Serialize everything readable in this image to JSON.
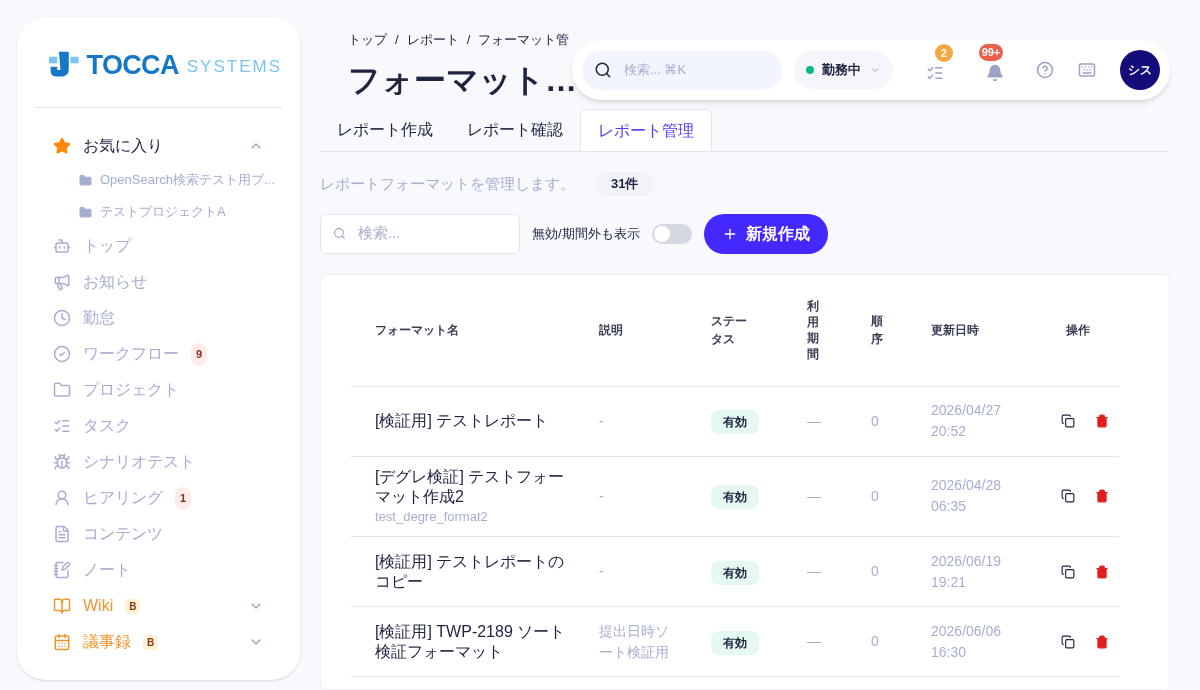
{
  "logo": {
    "name": "TOCCA",
    "suffix": "SYSTEMS"
  },
  "sidebar": {
    "items": [
      {
        "kind": "favorites",
        "label": "お気に入り",
        "expanded": true,
        "children": [
          {
            "label": "OpenSearch検索テスト用プ..."
          },
          {
            "label": "テストプロジェクトA"
          }
        ]
      },
      {
        "kind": "link",
        "label": "トップ"
      },
      {
        "kind": "link",
        "label": "お知らせ"
      },
      {
        "kind": "link",
        "label": "勤怠"
      },
      {
        "kind": "link",
        "label": "ワークフロー",
        "badge": "9"
      },
      {
        "kind": "link",
        "label": "プロジェクト"
      },
      {
        "kind": "link",
        "label": "タスク"
      },
      {
        "kind": "link",
        "label": "シナリオテスト"
      },
      {
        "kind": "link",
        "label": "ヒアリング",
        "badge": "1"
      },
      {
        "kind": "link",
        "label": "コンテンツ"
      },
      {
        "kind": "link",
        "label": "ノート"
      },
      {
        "kind": "beta-group",
        "label": "Wiki",
        "tag": "B",
        "expanded": false
      },
      {
        "kind": "beta-group",
        "label": "議事録",
        "tag": "B",
        "expanded": false
      }
    ]
  },
  "breadcrumb": [
    "トップ",
    "レポート",
    "フォーマット管"
  ],
  "breadcrumb_separator": "/",
  "page_title": "フォーマット…",
  "topbar": {
    "search": {
      "placeholder": "検索... ⌘K"
    },
    "status": {
      "label": "勤務中",
      "color": "#10b981"
    },
    "task_badge": "2",
    "notification_badge": "99+",
    "avatar": "シス"
  },
  "tabs": [
    {
      "label": "レポート作成",
      "selected": false
    },
    {
      "label": "レポート確認",
      "selected": false
    },
    {
      "label": "レポート管理",
      "selected": true
    }
  ],
  "description": "レポートフォーマットを管理します。",
  "count": "31件",
  "search": {
    "placeholder": "検索..."
  },
  "toggle": {
    "label": "無効/期間外も表示",
    "on": false
  },
  "new_button": "新規作成",
  "table": {
    "columns": [
      "フォーマット名",
      "説明",
      "ステータス",
      "利用期間",
      "順序",
      "更新日時",
      "操作"
    ],
    "rows": [
      {
        "name": "[検証用] テストレポート",
        "description": "-",
        "status": "有効",
        "period": "—",
        "order": "0",
        "updated": "2026/04/27 20:52"
      },
      {
        "name": "[デグレ検証] テストフォーマット作成2",
        "code": "test_degre_format2",
        "description": "-",
        "status": "有効",
        "period": "—",
        "order": "0",
        "updated": "2026/04/28 06:35"
      },
      {
        "name": "[検証用] テストレポートのコピー",
        "description": "-",
        "status": "有効",
        "period": "—",
        "order": "0",
        "updated": "2026/06/19 19:21"
      },
      {
        "name": "[検証用] TWP-2189 ソート検証フォーマット",
        "description": "提出日時ソート検証用",
        "status": "有効",
        "period": "—",
        "order": "0",
        "updated": "2026/06/06 16:30"
      }
    ]
  }
}
